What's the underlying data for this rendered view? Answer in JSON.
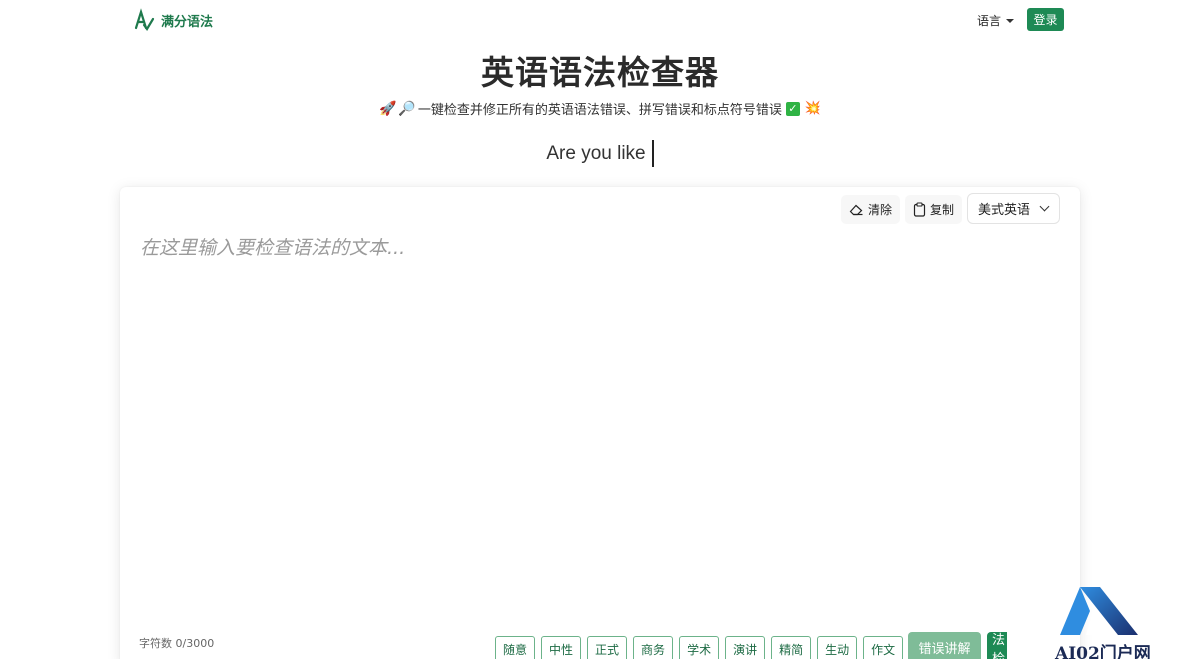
{
  "header": {
    "brand": "满分语法",
    "language_label": "语言",
    "login_label": "登录"
  },
  "hero": {
    "title": "英语语法检查器",
    "subtitle": "一键检查并修正所有的英语语法错误、拼写错误和标点符号错误",
    "typing_text": "Are you like"
  },
  "editor": {
    "clear_label": "清除",
    "copy_label": "复制",
    "dialect_selected": "美式英语",
    "placeholder": "在这里输入要检查语法的文本...",
    "char_count": "字符数 0/3000",
    "styles": [
      "随意",
      "中性",
      "正式",
      "商务",
      "学术",
      "演讲",
      "精简",
      "生动",
      "作文"
    ],
    "explain_label": "错误讲解",
    "check_label": "语法检查"
  },
  "watermark": {
    "text": "AI02门户网"
  },
  "colors": {
    "brand_green": "#1e8a55",
    "chip_border": "#6cb38a",
    "explain_bg": "#7fbc98"
  },
  "icons": [
    "logo-icon",
    "caret-down-icon",
    "rocket-icon",
    "magnifier-icon",
    "check-box-icon",
    "burst-icon",
    "eraser-icon",
    "clipboard-icon",
    "chevron-down-icon"
  ]
}
